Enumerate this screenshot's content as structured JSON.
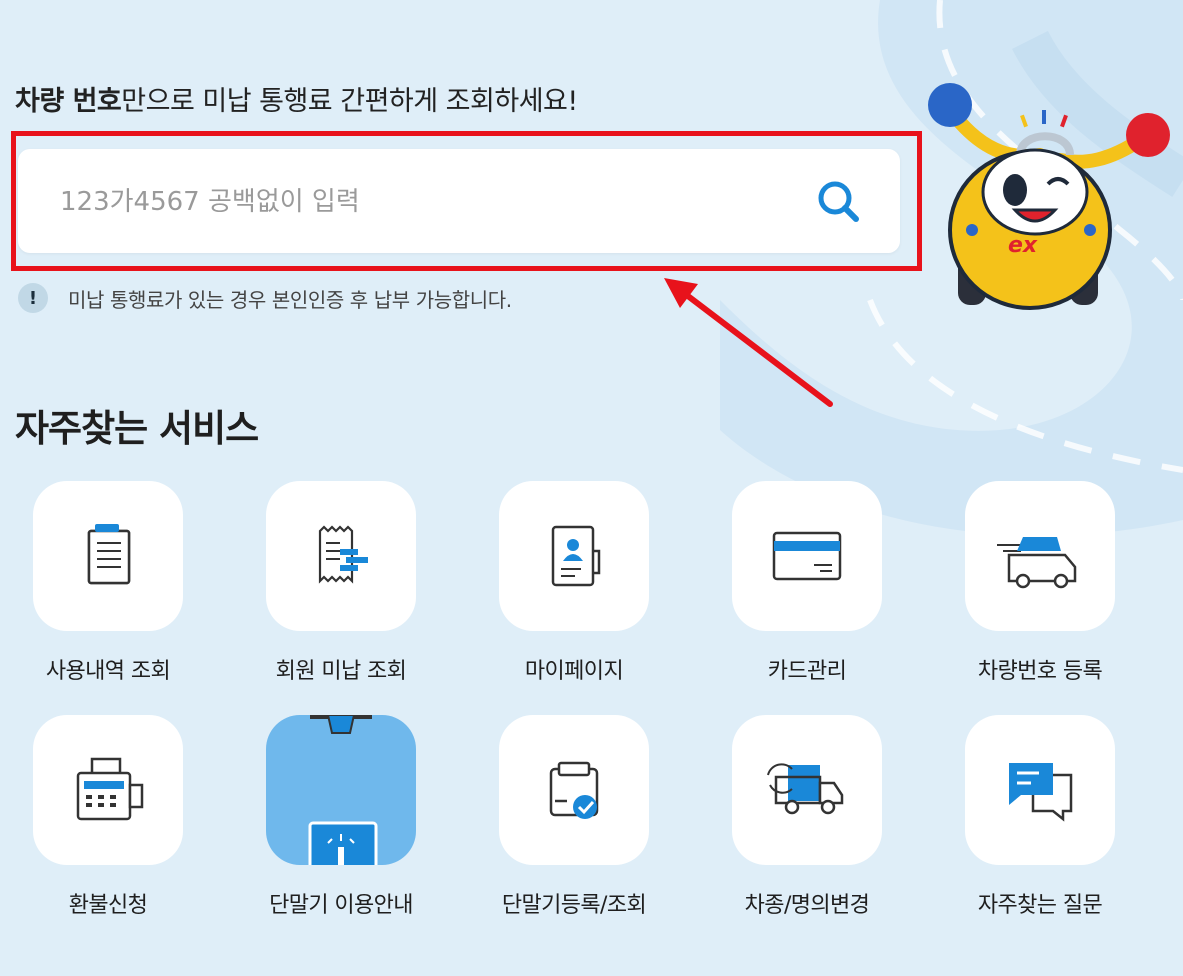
{
  "headline": {
    "strong": "차량 번호",
    "rest": "만으로 미납 통행료 간편하게 조회하세요!"
  },
  "search": {
    "placeholder": "123가4567 공백없이 입력",
    "value": "",
    "icon": "search-icon",
    "accent_color": "#1a88d8"
  },
  "notice": {
    "icon_glyph": "!",
    "text": "미납 통행료가 있는 경우 본인인증 후 납부 가능합니다."
  },
  "annotation": {
    "highlight_color": "#e8121b"
  },
  "mascot": {
    "label": "ex"
  },
  "services": {
    "title": "자주찾는 서비스",
    "items": [
      {
        "label": "사용내역 조회",
        "icon": "document-list-icon"
      },
      {
        "label": "회원 미납 조회",
        "icon": "receipt-icon"
      },
      {
        "label": "마이페이지",
        "icon": "profile-card-icon"
      },
      {
        "label": "카드관리",
        "icon": "credit-card-icon"
      },
      {
        "label": "차량번호 등록",
        "icon": "car-register-icon"
      },
      {
        "label": "환불신청",
        "icon": "fax-machine-icon"
      },
      {
        "label": "단말기 이용안내",
        "icon": "terminal-guide-icon"
      },
      {
        "label": "단말기등록/조회",
        "icon": "clipboard-check-icon"
      },
      {
        "label": "차종/명의변경",
        "icon": "truck-change-icon"
      },
      {
        "label": "자주찾는 질문",
        "icon": "chat-bubble-icon"
      }
    ]
  }
}
